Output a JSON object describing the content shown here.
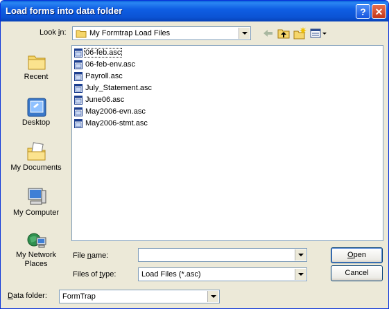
{
  "window": {
    "title": "Load forms into data folder"
  },
  "titlebar": {
    "help_glyph": "?",
    "close_glyph": "✕"
  },
  "lookin": {
    "label_pre": "Look ",
    "label_ul": "i",
    "label_post": "n:",
    "value": "My Formtrap Load Files"
  },
  "toolbar": {
    "icons": [
      "back-icon",
      "up-folder-icon",
      "new-folder-icon",
      "views-menu-icon"
    ]
  },
  "places": [
    {
      "name": "place-recent",
      "icon": "recent-icon",
      "label": "Recent"
    },
    {
      "name": "place-desktop",
      "icon": "desktop-icon",
      "label": "Desktop"
    },
    {
      "name": "place-my-documents",
      "icon": "my-documents-icon",
      "label": "My Documents"
    },
    {
      "name": "place-my-computer",
      "icon": "my-computer-icon",
      "label": "My Computer"
    },
    {
      "name": "place-my-network-places",
      "icon": "network-places-icon",
      "label": "My Network Places"
    }
  ],
  "files": [
    "06-feb.asc",
    "06-feb-env.asc",
    "Payroll.asc",
    "July_Statement.asc",
    "June06.asc",
    "May2006-evn.asc",
    "May2006-stmt.asc"
  ],
  "filename": {
    "label_pre": "File ",
    "label_ul": "n",
    "label_post": "ame:",
    "value": ""
  },
  "filetype": {
    "label_pre": "Files of ",
    "label_ul": "t",
    "label_post": "ype:",
    "value": "Load Files (*.asc)"
  },
  "buttons": {
    "open_ul": "O",
    "open_rest": "pen",
    "cancel": "Cancel"
  },
  "datafolder": {
    "label_ul": "D",
    "label_rest": "ata folder:",
    "value": "FormTrap"
  },
  "colors": {
    "titlebar": "#0b53d4",
    "dialog": "#ece9d8",
    "border": "#7f9db9"
  }
}
